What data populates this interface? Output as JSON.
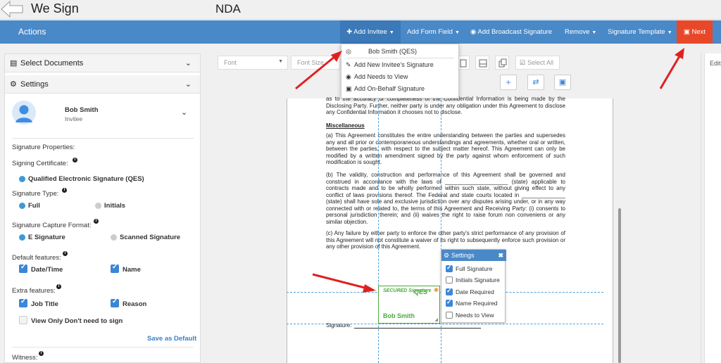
{
  "app": {
    "title": "We Sign",
    "document_title": "NDA"
  },
  "actionbar": {
    "actions_label": "Actions",
    "add_invitee": "Add Invitee",
    "add_form_field": "Add Form Field",
    "add_broadcast": "Add Broadcast Signature",
    "remove": "Remove",
    "signature_template": "Signature Template",
    "next": "Next"
  },
  "dropdown": {
    "items": [
      "Bob Smith (QES)",
      "Add New Invitee's Signature",
      "Add Needs to View",
      "Add On-Behalf Signature"
    ]
  },
  "left": {
    "select_documents": "Select Documents",
    "settings": "Settings",
    "user": {
      "name": "Bob Smith",
      "role": "Invitee"
    },
    "signature_properties": "Signature Properties:",
    "signing_certificate": "Signing Certificate:",
    "qes_option": "Qualified Electronic Signature (QES)",
    "signature_type": "Signature Type:",
    "type_full": "Full",
    "type_initials": "Initials",
    "capture_format": "Signature Capture Format:",
    "capture_e": "E Signature",
    "capture_scanned": "Scanned Signature",
    "default_features": "Default features:",
    "default_datetime": "Date/Time",
    "default_name": "Name",
    "extra_features": "Extra features:",
    "extra_jobtitle": "Job Title",
    "extra_reason": "Reason",
    "view_only": "View Only Don't need to sign",
    "save_as_default": "Save as Default",
    "witness": "Witness:"
  },
  "toolbar": {
    "font_placeholder": "Font",
    "font_size_placeholder": "Font Size",
    "select_all": "Select All"
  },
  "right": {
    "edit_label": "Edit"
  },
  "doc": {
    "top_text": "as to the accuracy or completeness of the Confidential Information is being made by the Disclosing Party. Further, neither party is under any obligation under this Agreement to disclose any Confidential Information it chooses not to disclose.",
    "heading": "Miscellaneous",
    "para_a": "(a) This Agreement constitutes the entire understanding between the parties and supersedes any and all prior or contemporaneous understandings and agreements, whether oral or written, between the parties, with respect to the subject matter hereof. This Agreement can only be modified by a written amendment signed by the party against whom enforcement of such modification is sought.",
    "para_b": "(b) The validity, construction and performance of this Agreement shall be governed and construed in accordance with the laws of ____________________ (state) applicable to contracts made and to be wholly performed within such state, without giving effect to any conflict of laws provisions thereof. The Federal and state courts located in ______________ (state) shall have sole and exclusive jurisdiction over any disputes arising under, or in any way connected with or related to, the terms of this Agreement and Receiving Party: (i) consents to personal jurisdiction therein; and (ii) waives the right to raise forum non conveniens or any similar objection.",
    "para_c": "(c) Any failure by either party to enforce the other party's strict performance of any provision of this Agreement will not constitute a waiver of its right to subsequently enforce such provision or any other provision of this Agreement.",
    "signature_label": "Signature:"
  },
  "sig_block": {
    "logo": "SECURED Signature",
    "qes": "QES",
    "name": "Bob Smith"
  },
  "settings_popup": {
    "title": "Settings",
    "items": [
      {
        "label": "Full Signature",
        "checked": true
      },
      {
        "label": "Initials Signature",
        "checked": false
      },
      {
        "label": "Date Required",
        "checked": true
      },
      {
        "label": "Name Required",
        "checked": true
      },
      {
        "label": "Needs to View",
        "checked": false
      }
    ]
  },
  "colors": {
    "brand_blue": "#4a89c8",
    "next_red": "#e8482a",
    "sig_green": "#4caa3e",
    "arrow_red": "#e02020"
  }
}
